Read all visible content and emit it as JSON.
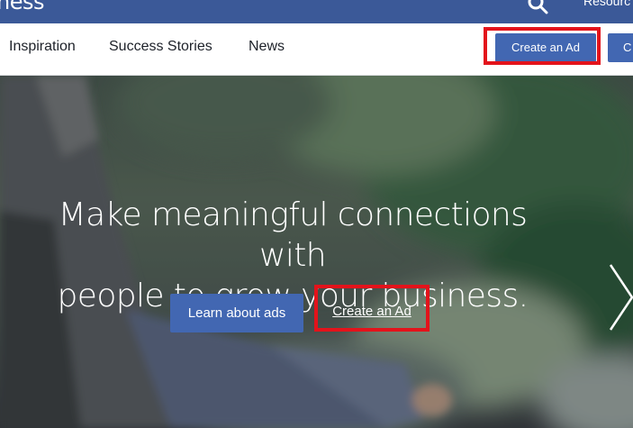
{
  "topbar": {
    "brand_fragment": "ness",
    "resources_label": "Resourc"
  },
  "nav": {
    "items": [
      {
        "label": "Inspiration"
      },
      {
        "label": "Success Stories"
      },
      {
        "label": "News"
      }
    ],
    "create_ad_label": "Create an Ad",
    "partial_button_label": "C"
  },
  "hero": {
    "headline_line1": "Make meaningful connections with",
    "headline_line2": "people to grow your business.",
    "learn_button_label": "Learn about ads",
    "create_button_label": "Create an Ad"
  },
  "colors": {
    "brand_blue": "#3b5998",
    "button_blue": "#4267b2",
    "highlight_red": "#e3131b"
  },
  "icons": {
    "search": "search-icon",
    "next": "chevron-right-icon"
  }
}
